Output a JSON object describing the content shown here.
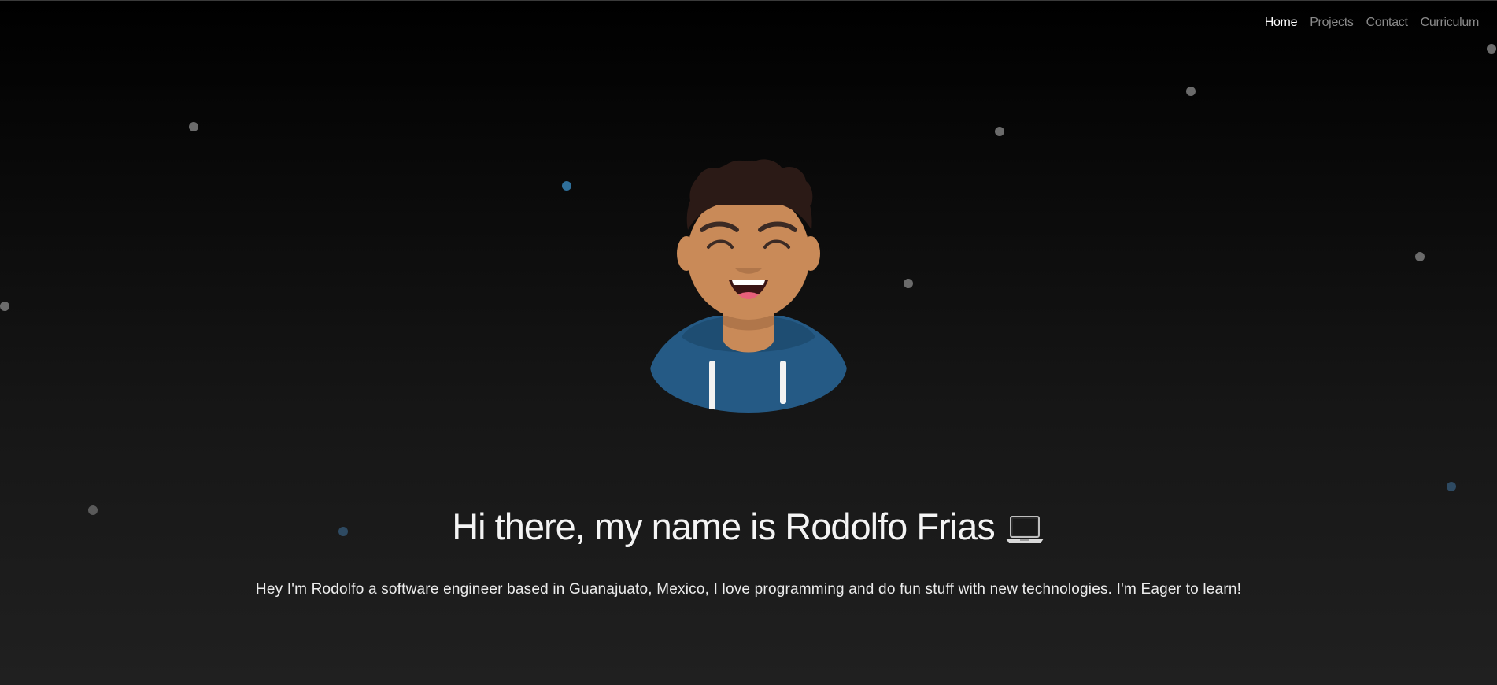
{
  "nav": {
    "items": [
      {
        "label": "Home",
        "active": true
      },
      {
        "label": "Projects",
        "active": false
      },
      {
        "label": "Contact",
        "active": false
      },
      {
        "label": "Curriculum",
        "active": false
      }
    ]
  },
  "hero": {
    "title": "Hi there, my name is Rodolfo Frias",
    "title_icon": "laptop-icon",
    "intro": "Hey I'm Rodolfo a software engineer based in Guanajuato, Mexico, I love programming and do fun stuff with new technologies. I'm Eager to learn!",
    "avatar_icon": "smiling-boy-avatar"
  },
  "colors": {
    "background_top": "#000000",
    "background_bottom": "#202020",
    "nav_active": "#ffffff",
    "nav_inactive": "#8a8a8a",
    "particle_gray": "#6b6b6b",
    "particle_blue": "#2f6f9a",
    "hoodie": "#255a85",
    "skin": "#c98a58"
  }
}
